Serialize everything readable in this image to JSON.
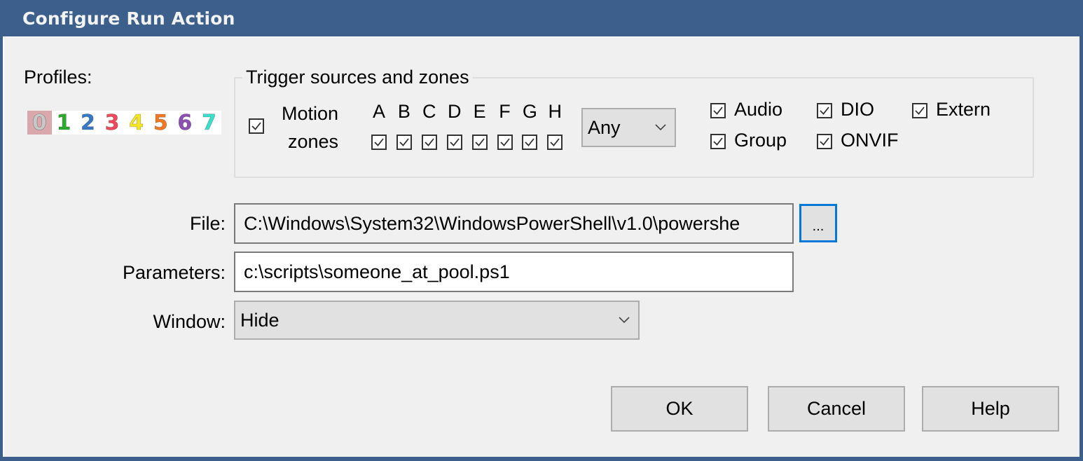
{
  "window": {
    "title": "Configure Run Action"
  },
  "profiles": {
    "label": "Profiles:",
    "items": [
      {
        "digit": "0",
        "color": "#c8c8c8",
        "active": true
      },
      {
        "digit": "1",
        "color": "#2eaa2e",
        "active": false
      },
      {
        "digit": "2",
        "color": "#3579c4",
        "active": false
      },
      {
        "digit": "3",
        "color": "#ee4a5a",
        "active": false
      },
      {
        "digit": "4",
        "color": "#f4e524",
        "active": false
      },
      {
        "digit": "5",
        "color": "#f07a22",
        "active": false
      },
      {
        "digit": "6",
        "color": "#8d4fb2",
        "active": false
      },
      {
        "digit": "7",
        "color": "#3be0cc",
        "active": false
      }
    ]
  },
  "triggers": {
    "group_title": "Trigger sources and zones",
    "motion": {
      "label_line1": "Motion",
      "label_line2": "zones",
      "checked": true
    },
    "zones": [
      {
        "letter": "A",
        "checked": true
      },
      {
        "letter": "B",
        "checked": true
      },
      {
        "letter": "C",
        "checked": true
      },
      {
        "letter": "D",
        "checked": true
      },
      {
        "letter": "E",
        "checked": true
      },
      {
        "letter": "F",
        "checked": true
      },
      {
        "letter": "G",
        "checked": true
      },
      {
        "letter": "H",
        "checked": true
      }
    ],
    "zone_mode": {
      "selected": "Any"
    },
    "sources": [
      {
        "label": "Audio",
        "checked": true
      },
      {
        "label": "DIO",
        "checked": true
      },
      {
        "label": "Extern",
        "checked": true
      },
      {
        "label": "Group",
        "checked": true
      },
      {
        "label": "ONVIF",
        "checked": true
      }
    ]
  },
  "form": {
    "file_label": "File:",
    "file_value": "C:\\Windows\\System32\\WindowsPowerShell\\v1.0\\powershe",
    "browse_label": "...",
    "parameters_label": "Parameters:",
    "parameters_value": "c:\\scripts\\someone_at_pool.ps1",
    "window_label": "Window:",
    "window_selected": "Hide"
  },
  "buttons": {
    "ok": "OK",
    "cancel": "Cancel",
    "help": "Help"
  }
}
